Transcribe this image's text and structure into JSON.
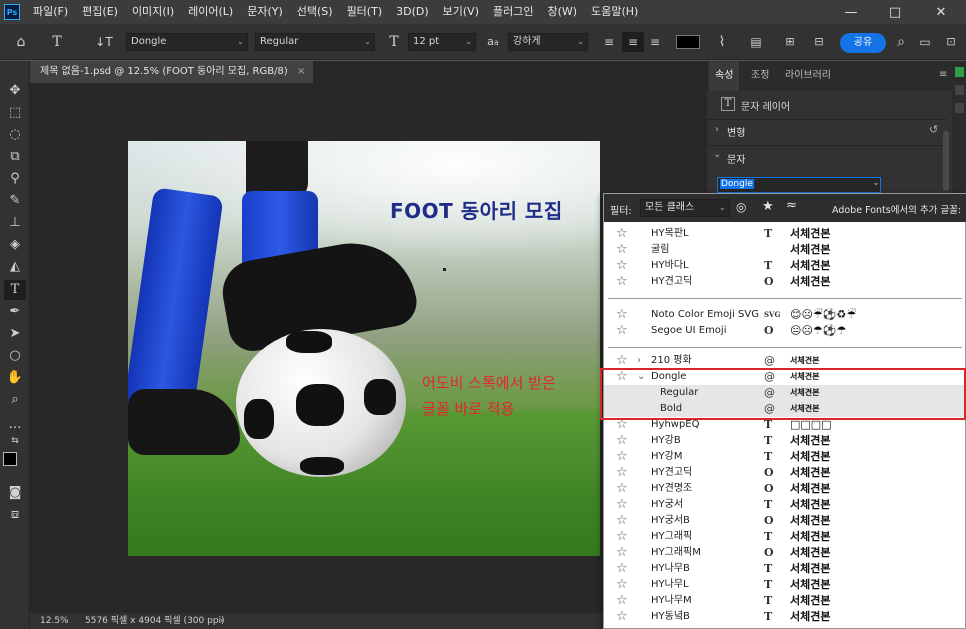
{
  "app": {
    "logo": "Ps",
    "menu": [
      "파일(F)",
      "편집(E)",
      "이미지(I)",
      "레이어(L)",
      "문자(Y)",
      "선택(S)",
      "필터(T)",
      "3D(D)",
      "보기(V)",
      "플러그인",
      "창(W)",
      "도움말(H)"
    ],
    "window_controls": [
      "—",
      "□",
      "✕"
    ]
  },
  "options": {
    "font_family": "Dongle",
    "font_style": "Regular",
    "font_size": "12 pt",
    "anti_alias_label": "a",
    "anti_alias": "강하게",
    "share_button": "공유",
    "color_swatch": "#000000"
  },
  "document": {
    "tab_title": "제목 없음-1.psd @ 12.5% (FOOT 동아리 모집, RGB/8)",
    "close": "×",
    "poster_title": "FOOT 동아리 모집",
    "annotation_line1": "어도비 스톡에서 받은",
    "annotation_line2": "글꼴 바로 적용"
  },
  "status": {
    "zoom": "12.5%",
    "dimensions": "5576 픽셀 x 4904 픽셀 (300 ppi)",
    "arrow": "›"
  },
  "panel": {
    "tabs": [
      "속성",
      "조정",
      "라이브러리"
    ],
    "layer_kind": "문자 레이어",
    "section_transform": "변형",
    "section_text": "문자",
    "font_field": "Dongle",
    "section_chev_closed": "›",
    "section_chev_open": "⌄"
  },
  "font_panel": {
    "filter_label": "필터:",
    "filter_value": "모든 클래스",
    "adobe_fonts_label": "Adobe Fonts에서의 추가 글꼴:",
    "group1": [
      {
        "name": "HY목판L",
        "type": "T",
        "sample": "서체견본"
      },
      {
        "name": "굴림",
        "type": "",
        "sample": "서체견본"
      },
      {
        "name": "HY바다L",
        "type": "T",
        "sample": "서체견본"
      },
      {
        "name": "HY견고딕",
        "type": "O",
        "sample": "서체견본"
      }
    ],
    "group2": [
      {
        "name": "Noto Color Emoji SVG",
        "type": "SVG",
        "sample": "😊☹☔⚽♻☔"
      },
      {
        "name": "Segoe UI Emoji",
        "type": "O",
        "sample": "😐☹☂⚽☂"
      }
    ],
    "group3": [
      {
        "name": "210 평화",
        "type": "@",
        "sample": "서체견본",
        "expand": "›"
      },
      {
        "name": "Dongle",
        "type": "@",
        "sample": "서체견본",
        "expand": "⌄"
      },
      {
        "name": "Regular",
        "type": "@",
        "sample": "서체견본"
      },
      {
        "name": "Bold",
        "type": "@",
        "sample": "서체견본"
      },
      {
        "name": "HyhwpEQ",
        "type": "T",
        "sample": "□□□□"
      },
      {
        "name": "HY강B",
        "type": "T",
        "sample": "서체견본"
      },
      {
        "name": "HY강M",
        "type": "T",
        "sample": "서체견본"
      },
      {
        "name": "HY견고딕",
        "type": "O",
        "sample": "서체견본"
      },
      {
        "name": "HY견명조",
        "type": "O",
        "sample": "서체견본"
      },
      {
        "name": "HY궁서",
        "type": "T",
        "sample": "서체견본"
      },
      {
        "name": "HY궁서B",
        "type": "O",
        "sample": "서체견본"
      },
      {
        "name": "HY그래픽",
        "type": "T",
        "sample": "서체견본"
      },
      {
        "name": "HY그래픽M",
        "type": "O",
        "sample": "서체견본"
      },
      {
        "name": "HY나무B",
        "type": "T",
        "sample": "서체견본"
      },
      {
        "name": "HY나무L",
        "type": "T",
        "sample": "서체견본"
      },
      {
        "name": "HY나무M",
        "type": "T",
        "sample": "서체견본"
      },
      {
        "name": "HY동녘B",
        "type": "T",
        "sample": "서체견본"
      }
    ],
    "star": "☆",
    "highlight_color": "#d9262a"
  },
  "colors": {
    "accent": "#1473e6",
    "annotation": "#e0282d",
    "poster_title": "#1f2c8a"
  }
}
